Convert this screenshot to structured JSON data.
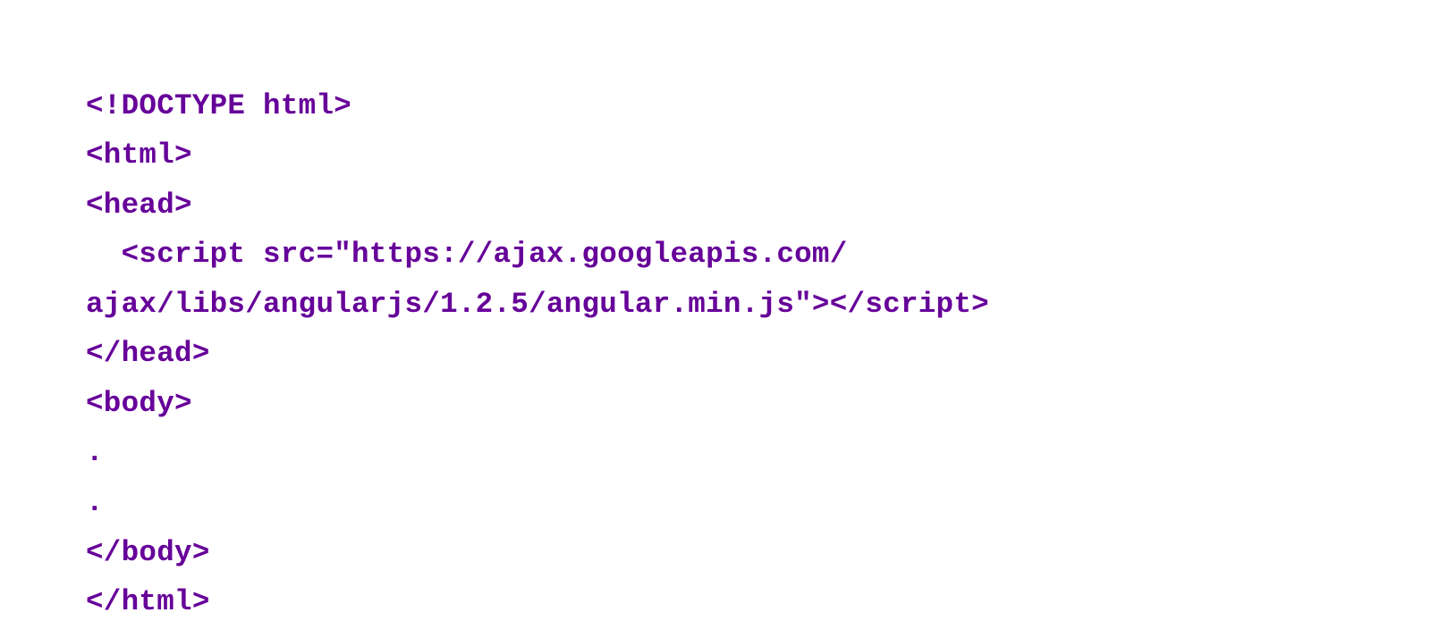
{
  "code": {
    "lines": [
      "<!DOCTYPE html>",
      "<html>",
      "<head>",
      "  <script src=\"https://ajax.googleapis.com/",
      "ajax/libs/angularjs/1.2.5/angular.min.js\"></script>",
      "</head>",
      "<body>",
      ".",
      ".",
      "</body>",
      "</html>"
    ],
    "text_color": "#660099",
    "font_family": "Courier New"
  }
}
